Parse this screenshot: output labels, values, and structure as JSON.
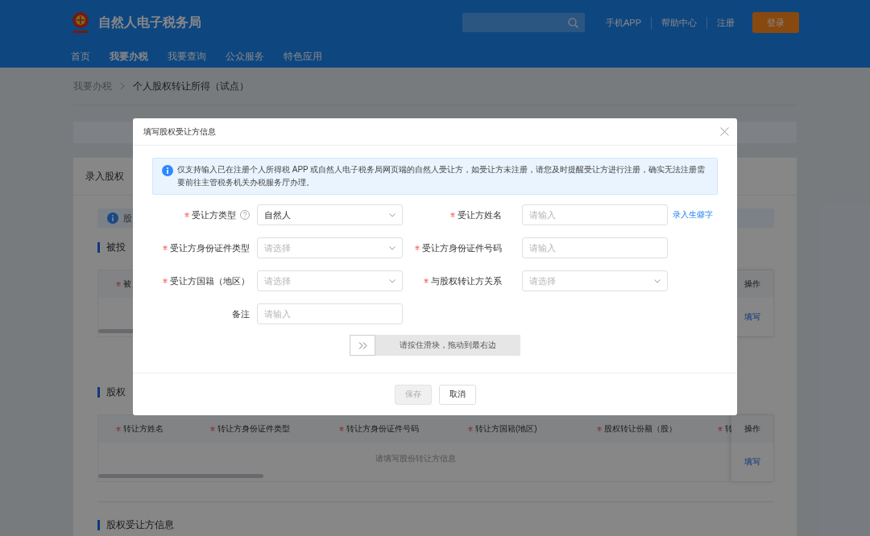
{
  "header": {
    "site_title": "自然人电子税务局",
    "links": [
      "手机APP",
      "帮助中心",
      "注册"
    ],
    "login_button": "登录"
  },
  "nav": [
    {
      "label": "首页",
      "selected": false
    },
    {
      "label": "我要办税",
      "selected": true
    },
    {
      "label": "我要查询",
      "selected": false
    },
    {
      "label": "公众服务",
      "selected": false
    },
    {
      "label": "特色应用",
      "selected": false
    }
  ],
  "breadcrumb": [
    {
      "label": "我要办税",
      "current": false
    },
    {
      "label": "个人股权转让所得（试点）",
      "current": true
    }
  ],
  "page": {
    "card_title": "录入股权",
    "notice": "股",
    "sections": [
      {
        "title": "被投",
        "table": {
          "columns": [
            {
              "label": "被",
              "required": true
            }
          ],
          "action_column": "操作",
          "action_link": "填写"
        }
      },
      {
        "title": "股权",
        "table": {
          "columns": [
            {
              "label": "转让方姓名",
              "required": true
            },
            {
              "label": "转让方身份证件类型",
              "required": true
            },
            {
              "label": "转让方身份证件号码",
              "required": true
            },
            {
              "label": "转让方国籍(地区)",
              "required": true
            },
            {
              "label": "股权转让份额（股）",
              "required": true
            },
            {
              "label": "转",
              "required": true
            }
          ],
          "action_column": "操作",
          "empty_text": "请填写股份转让方信息",
          "action_link": "填写"
        }
      },
      {
        "title": "股权受让方信息"
      }
    ]
  },
  "modal": {
    "title": "填写股权受让方信息",
    "alert": "仅支持输入已在注册个人所得税 APP 或自然人电子税务局网页端的自然人受让方，如受让方未注册，请您及时提醒受让方进行注册，确实无法注册需要前往主管税务机关办税服务厅办理。",
    "fields": [
      {
        "label": "受让方类型",
        "required": true,
        "help": true,
        "kind": "select",
        "value": "自然人"
      },
      {
        "label": "受让方姓名",
        "required": true,
        "help": false,
        "kind": "input",
        "placeholder": "请输入",
        "link": "录入生僻字"
      },
      {
        "label": "受让方身份证件类型",
        "required": true,
        "help": false,
        "kind": "select",
        "placeholder": "请选择"
      },
      {
        "label": "受让方身份证件号码",
        "required": true,
        "help": false,
        "kind": "input",
        "placeholder": "请输入"
      },
      {
        "label": "受让方国籍（地区）",
        "required": true,
        "help": false,
        "kind": "select",
        "placeholder": "请选择"
      },
      {
        "label": "与股权转让方关系",
        "required": true,
        "help": false,
        "kind": "select",
        "placeholder": "请选择"
      },
      {
        "label": "备注",
        "required": false,
        "help": false,
        "kind": "input",
        "placeholder": "请输入"
      }
    ],
    "slider": {
      "hint": "请按住滑块，拖动到最右边"
    },
    "buttons": [
      {
        "label": "保存",
        "disabled": true
      },
      {
        "label": "取消",
        "disabled": false
      }
    ]
  }
}
